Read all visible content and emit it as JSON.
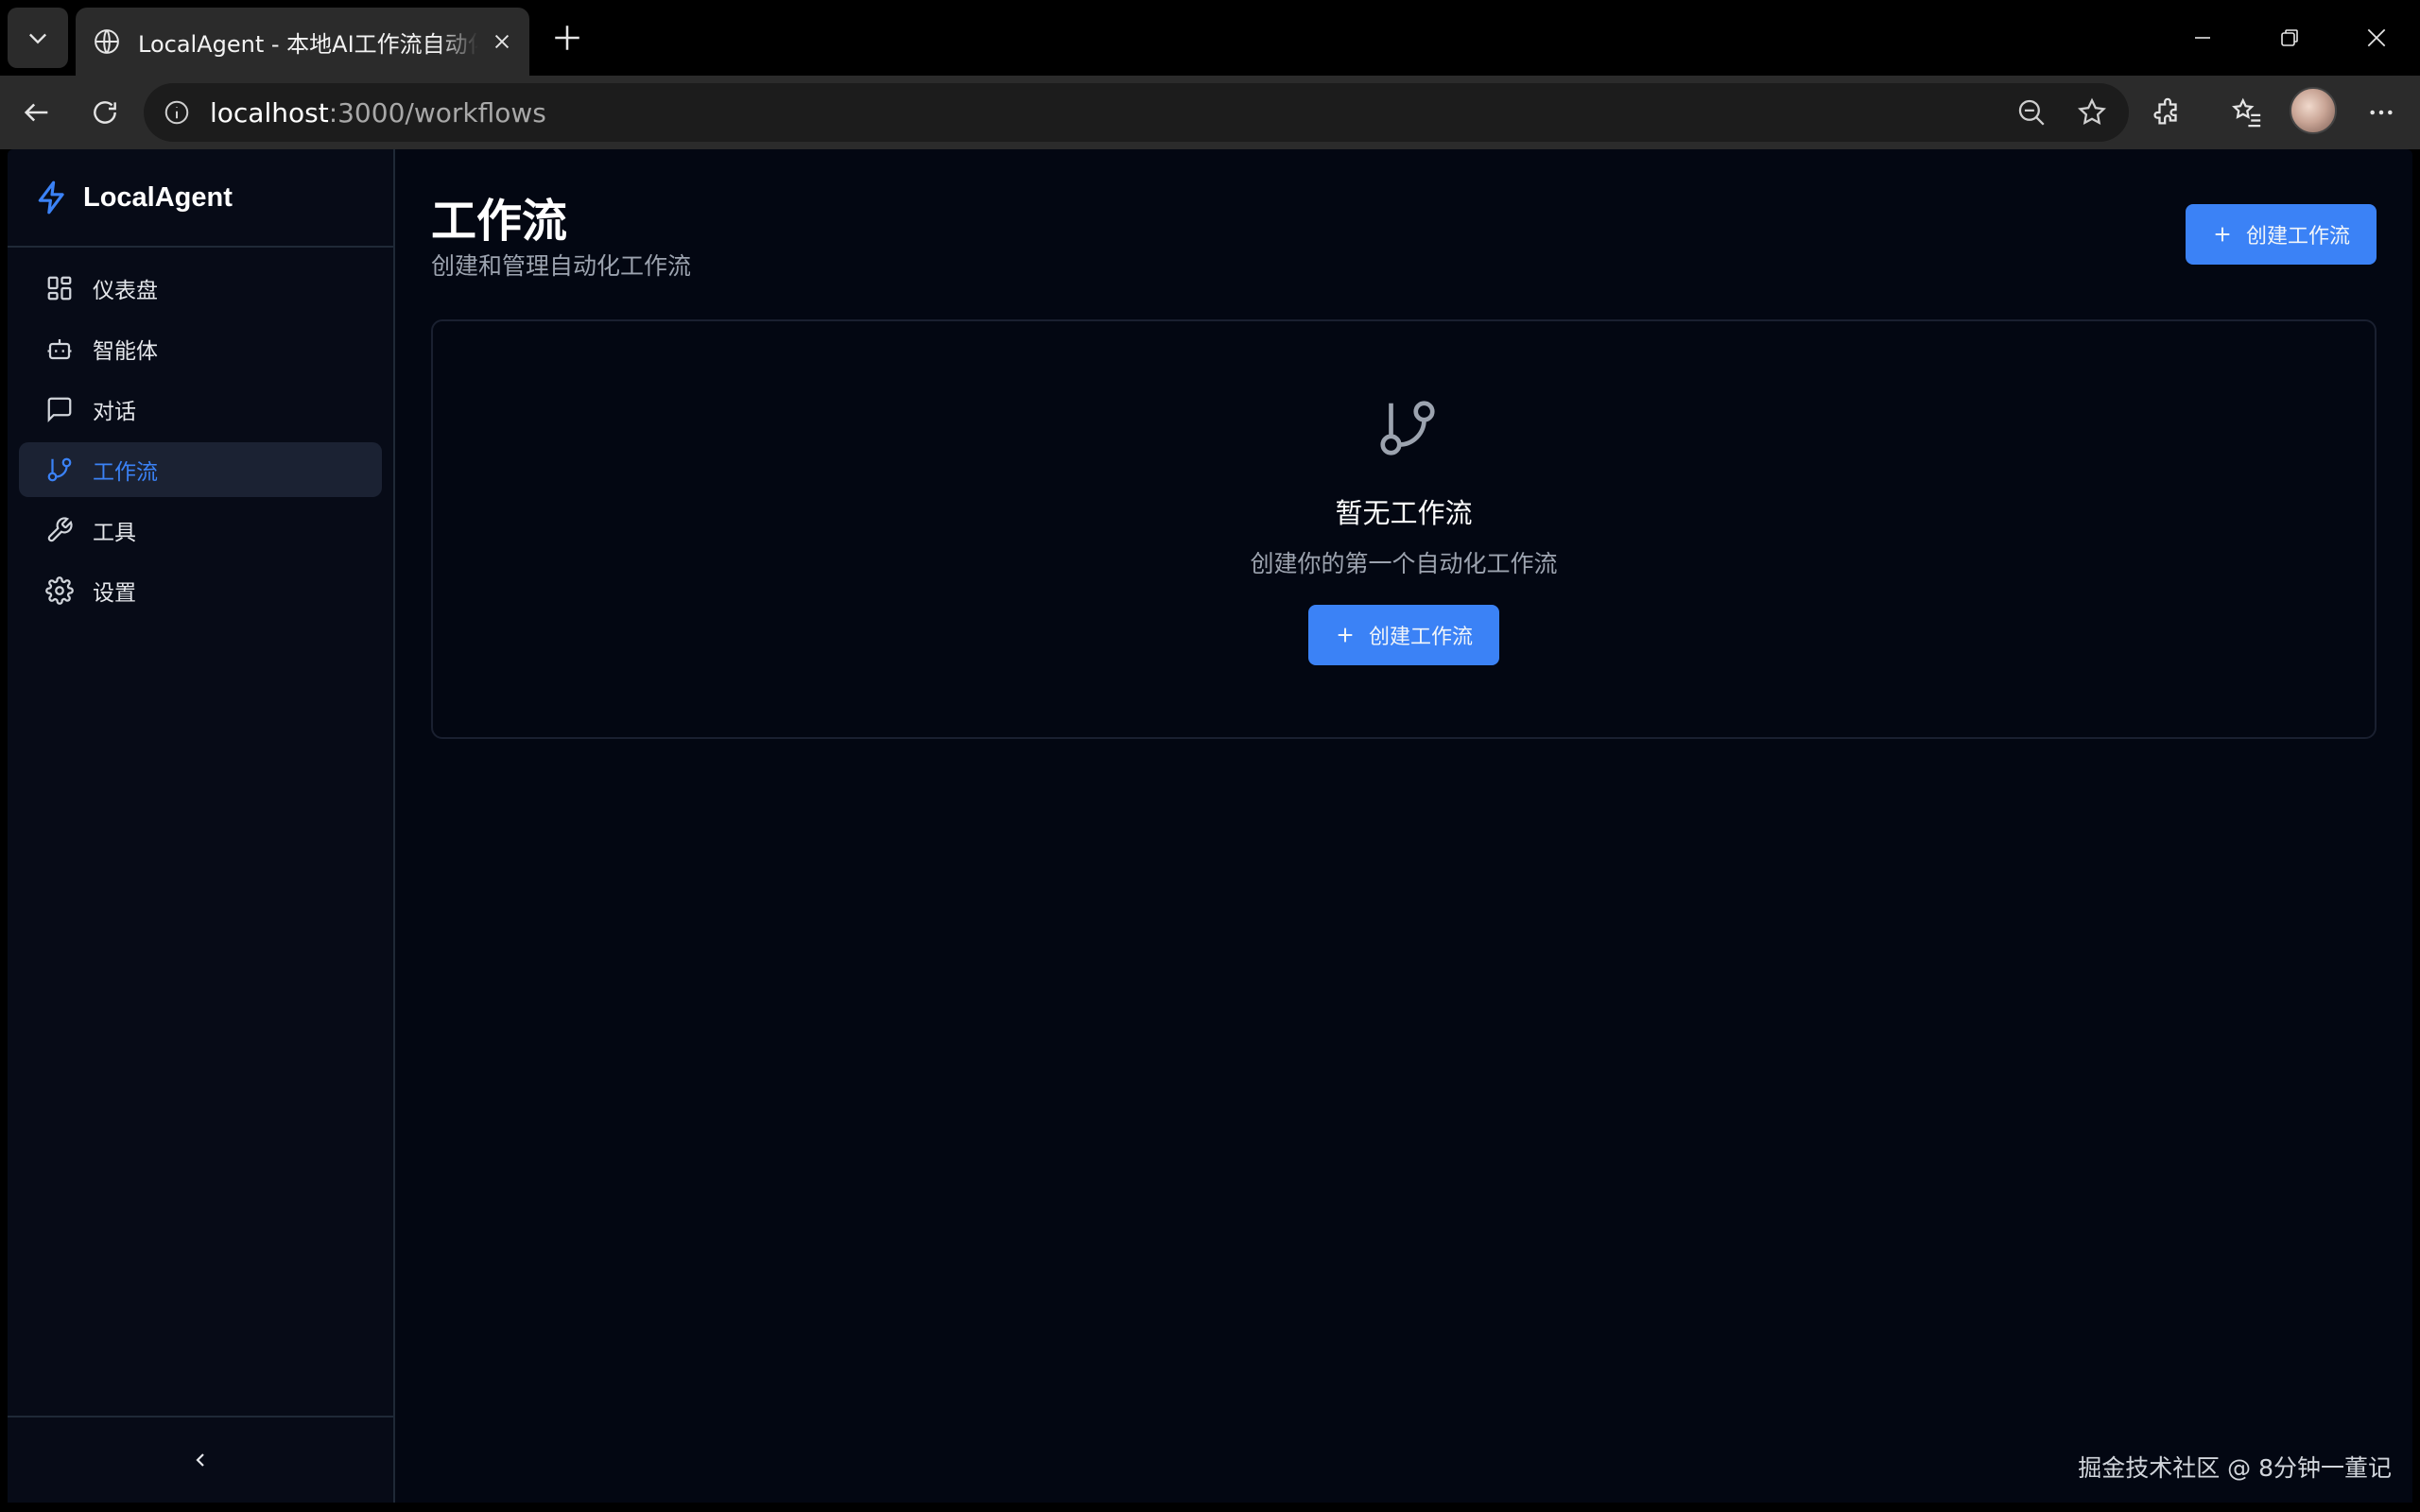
{
  "browser": {
    "tab_title": "LocalAgent - 本地AI工作流自动化平台",
    "url_host": "localhost",
    "url_path": ":3000/workflows"
  },
  "app": {
    "brand_name": "LocalAgent",
    "sidebar": {
      "items": [
        {
          "label": "仪表盘",
          "icon": "dashboard-icon"
        },
        {
          "label": "智能体",
          "icon": "bot-icon"
        },
        {
          "label": "对话",
          "icon": "chat-icon"
        },
        {
          "label": "工作流",
          "icon": "git-branch-icon",
          "active": true
        },
        {
          "label": "工具",
          "icon": "wrench-icon"
        },
        {
          "label": "设置",
          "icon": "gear-icon"
        }
      ]
    },
    "page": {
      "title": "工作流",
      "subtitle": "创建和管理自动化工作流",
      "create_button_label": "创建工作流"
    },
    "empty_state": {
      "title": "暂无工作流",
      "description": "创建你的第一个自动化工作流",
      "button_label": "创建工作流"
    },
    "watermark": "掘金技术社区 @ 8分钟一董记"
  },
  "colors": {
    "accent": "#3b82f6",
    "background": "#030712",
    "sidebar_bg": "#070b17",
    "active_item_bg": "#1b2233"
  }
}
